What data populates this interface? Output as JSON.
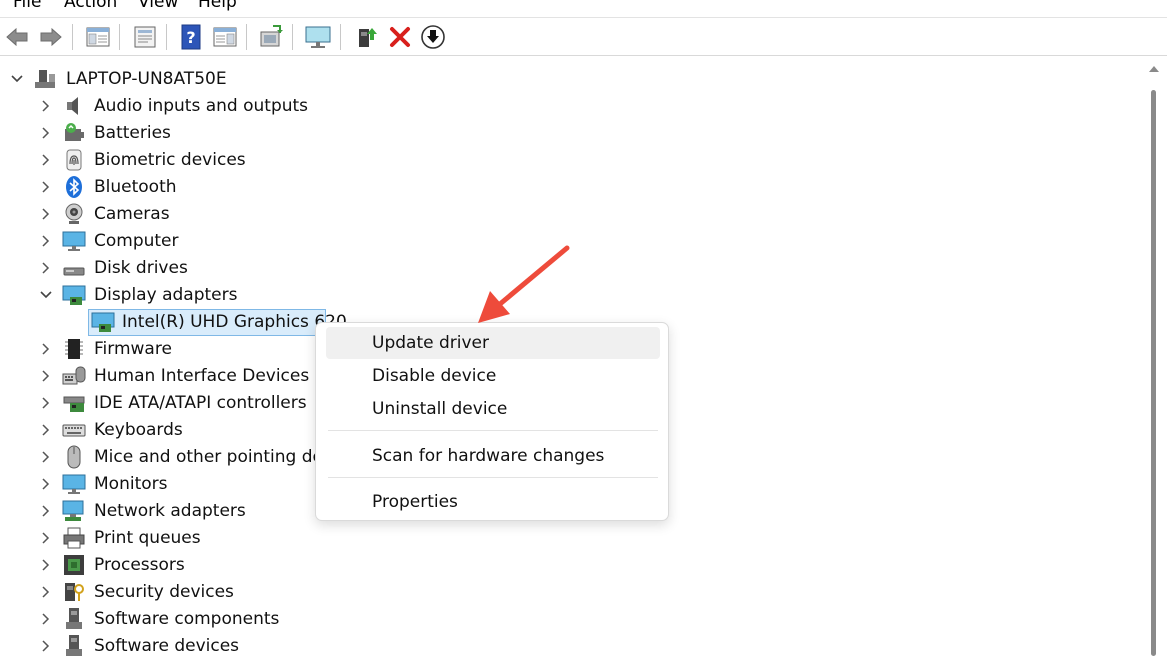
{
  "menubar": {
    "file": "File",
    "action": "Action",
    "view": "View",
    "help": "Help"
  },
  "toolbar": {
    "buttons": [
      "back-icon",
      "forward-icon",
      "show-hide-console-tree-icon",
      "properties-icon",
      "help-icon",
      "action-pane-icon",
      "scan-hardware-icon",
      "monitor-icon",
      "update-driver-icon",
      "uninstall-icon",
      "disable-device-icon"
    ]
  },
  "tree": {
    "root": "LAPTOP-UN8AT50E",
    "items": [
      {
        "label": "Audio inputs and outputs"
      },
      {
        "label": "Batteries"
      },
      {
        "label": "Biometric devices"
      },
      {
        "label": "Bluetooth"
      },
      {
        "label": "Cameras"
      },
      {
        "label": "Computer"
      },
      {
        "label": "Disk drives"
      },
      {
        "label": "Display adapters"
      },
      {
        "label": "Intel(R) UHD Graphics 620"
      },
      {
        "label": "Firmware"
      },
      {
        "label": "Human Interface Devices"
      },
      {
        "label": "IDE ATA/ATAPI controllers"
      },
      {
        "label": "Keyboards"
      },
      {
        "label": "Mice and other pointing devices"
      },
      {
        "label": "Monitors"
      },
      {
        "label": "Network adapters"
      },
      {
        "label": "Print queues"
      },
      {
        "label": "Processors"
      },
      {
        "label": "Security devices"
      },
      {
        "label": "Software components"
      },
      {
        "label": "Software devices"
      }
    ]
  },
  "context_menu": {
    "update_driver": "Update driver",
    "disable_device": "Disable device",
    "uninstall_device": "Uninstall device",
    "scan_hardware": "Scan for hardware changes",
    "properties": "Properties"
  },
  "colors": {
    "selection": "#d9ecfb",
    "selection_border": "#7fb8e6",
    "annotation_arrow": "#ee4b3b",
    "uninstall_red": "#d8201c"
  }
}
